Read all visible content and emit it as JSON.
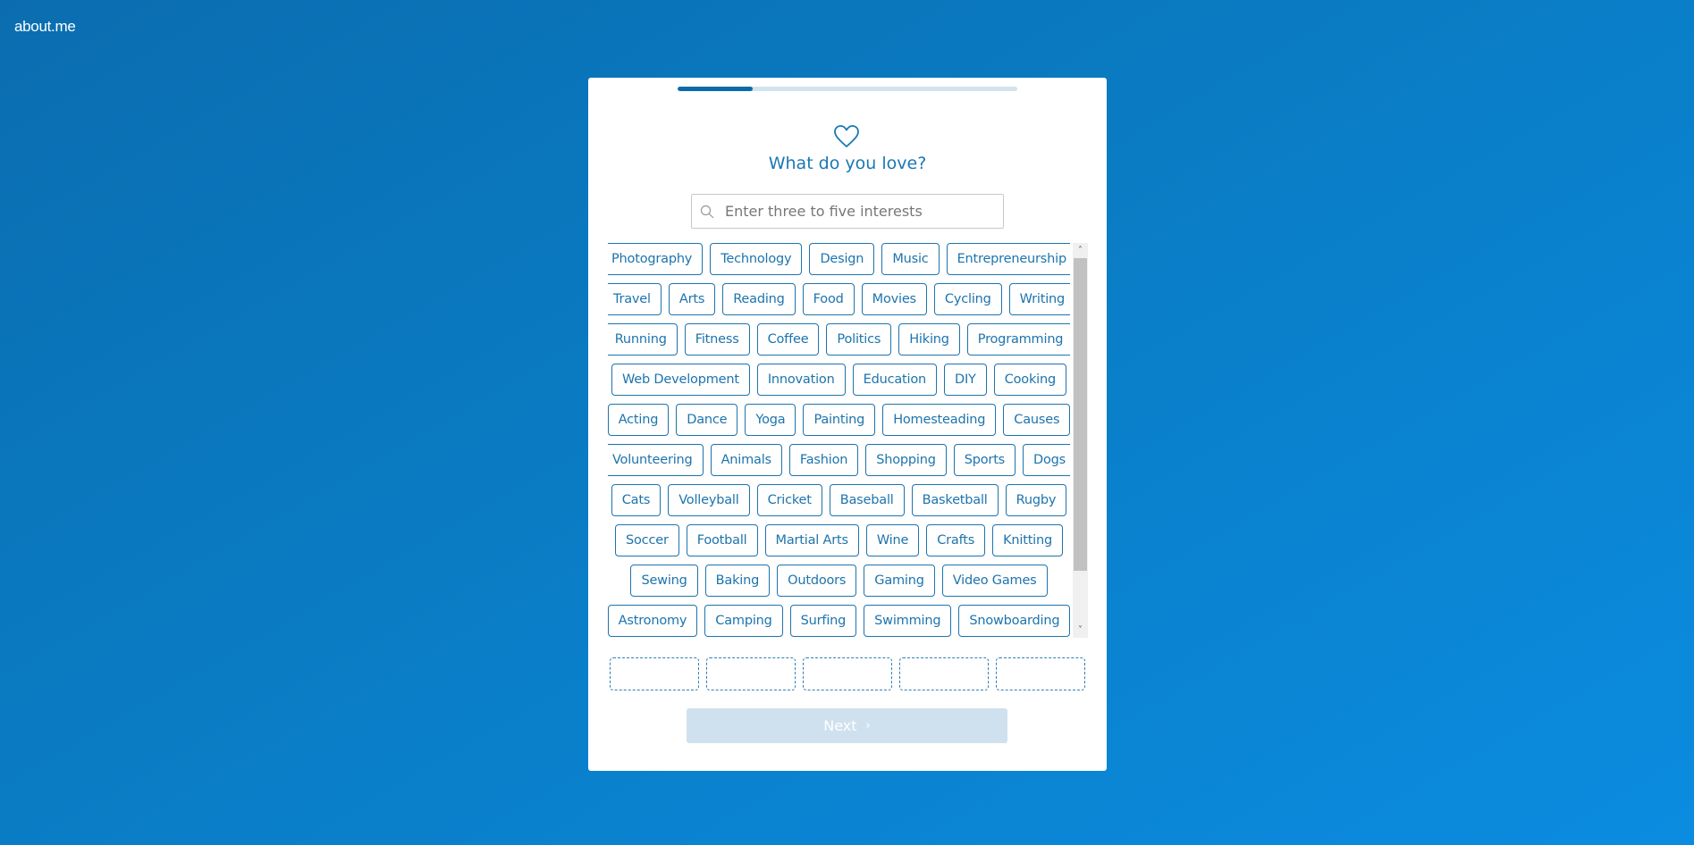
{
  "app": {
    "logo": "about.me"
  },
  "onboarding": {
    "progress_percent": 22,
    "icon": "heart-icon",
    "title": "What do you love?",
    "search": {
      "placeholder": "Enter three to five interests",
      "value": "",
      "icon": "search-icon"
    },
    "tag_rows": [
      [
        "Photography",
        "Technology",
        "Design",
        "Music",
        "Entrepreneurship"
      ],
      [
        "Travel",
        "Arts",
        "Reading",
        "Food",
        "Movies",
        "Cycling",
        "Writing"
      ],
      [
        "Running",
        "Fitness",
        "Coffee",
        "Politics",
        "Hiking",
        "Programming"
      ],
      [
        "Web Development",
        "Innovation",
        "Education",
        "DIY",
        "Cooking"
      ],
      [
        "Acting",
        "Dance",
        "Yoga",
        "Painting",
        "Homesteading",
        "Causes"
      ],
      [
        "Volunteering",
        "Animals",
        "Fashion",
        "Shopping",
        "Sports",
        "Dogs"
      ],
      [
        "Cats",
        "Volleyball",
        "Cricket",
        "Baseball",
        "Basketball",
        "Rugby"
      ],
      [
        "Soccer",
        "Football",
        "Martial Arts",
        "Wine",
        "Crafts",
        "Knitting"
      ],
      [
        "Sewing",
        "Baking",
        "Outdoors",
        "Gaming",
        "Video Games"
      ],
      [
        "Astronomy",
        "Camping",
        "Surfing",
        "Swimming",
        "Snowboarding"
      ]
    ],
    "selected_slots": [
      "",
      "",
      "",
      "",
      ""
    ],
    "next_button": {
      "label": "Next",
      "icon": "chevron-right-icon",
      "disabled": true
    }
  },
  "colors": {
    "accent": "#1d74ad",
    "progress_fill": "#0b6aaa",
    "progress_track": "#d3e3ee",
    "next_disabled_bg": "#cfe1ee",
    "background_start": "#0b6db0",
    "background_end": "#0b8ce0"
  }
}
